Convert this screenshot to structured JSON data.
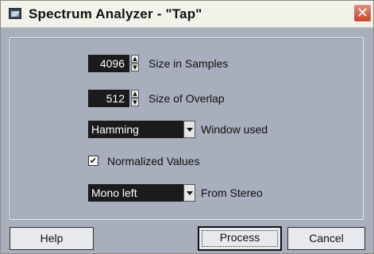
{
  "window": {
    "title": "Spectrum Analyzer - \"Tap\"",
    "close_glyph": "✕"
  },
  "settings": {
    "size_in_samples": {
      "value": "4096",
      "label": "Size in Samples"
    },
    "size_of_overlap": {
      "value": "512",
      "label": "Size of Overlap"
    },
    "window_used": {
      "selected": "Hamming",
      "label": "Window used"
    },
    "normalized_values": {
      "checked": true,
      "check_glyph": "✔",
      "label": "Normalized Values"
    },
    "from_stereo": {
      "selected": "Mono left",
      "label": "From Stereo"
    }
  },
  "buttons": {
    "help": "Help",
    "process": "Process",
    "cancel": "Cancel"
  },
  "icons": {
    "app": "spectrum-analyzer-icon",
    "close": "close-icon",
    "spin_up": "▲",
    "spin_down": "▼"
  },
  "colors": {
    "panel": "#a8aebb",
    "titlebar": "#f2f1ea",
    "close": "#c8452a",
    "field": "#1b1b1b"
  }
}
